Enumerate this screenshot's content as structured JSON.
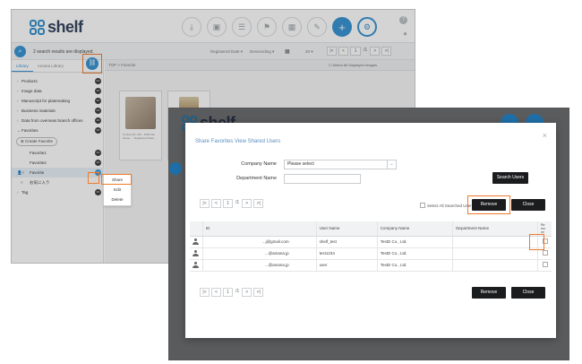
{
  "app": {
    "brand": "shelf",
    "toolbar": {
      "results_text": "2 search results are displayed.",
      "sort_field": "Registered Date ▾",
      "sort_order": "Descending ▾",
      "per_page": "20 ▾",
      "page_current": "1",
      "page_total": "/1"
    },
    "sidebar": {
      "tabs": [
        "Library",
        "Amana Library"
      ],
      "items": [
        {
          "label": "Products"
        },
        {
          "label": "Image data"
        },
        {
          "label": "Manuscript for platemaking"
        },
        {
          "label": "Business materials"
        },
        {
          "label": "Data from overseas branch offices"
        },
        {
          "label": "Favorites"
        }
      ],
      "create_favorite": "Create Favorite",
      "favorites": [
        {
          "label": "Favorite1"
        },
        {
          "label": "Favorite2"
        },
        {
          "label": "Favorite"
        },
        {
          "label": "お気に入り"
        }
      ],
      "tag": "Tag"
    },
    "context_menu": [
      "Share",
      "Edit",
      "Delete"
    ],
    "content": {
      "path": "TOP > Favorite",
      "select_all": "Select All Displayed Images",
      "thumbnails": [
        {
          "meta": "Content ID: 234 · 3030\nFile Name: ... \nRegistered Date ..."
        },
        {
          "meta": "..."
        }
      ]
    }
  },
  "modal": {
    "title": "Share Favorites View Shared Users",
    "close": "×",
    "company_label": "Company Name",
    "company_value": "Please select",
    "department_label": "Department Name",
    "search_button": "Search Users",
    "select_all_label": "Select All Searched Users",
    "remove_button": "Remove",
    "close_button": "Close",
    "page_current": "1",
    "page_total": "/1",
    "table": {
      "headers": [
        "ID",
        "User Name",
        "Company Name",
        "Department Name",
        "Re mo ve"
      ],
      "rows": [
        {
          "id": "...j@gmail.com",
          "user": "shelf_test",
          "company": "TestD Co., Ltd.",
          "dept": ""
        },
        {
          "id": "...@amana.jp",
          "user": "test1234",
          "company": "TestD Co., Ltd.",
          "dept": ""
        },
        {
          "id": "...@amana.jp",
          "user": "user",
          "company": "TestD Co., Ltd.",
          "dept": ""
        }
      ]
    }
  },
  "colors": {
    "accent": "#2e8fd1",
    "highlight": "#f07a2a",
    "dark_button": "#1b1c1e"
  }
}
